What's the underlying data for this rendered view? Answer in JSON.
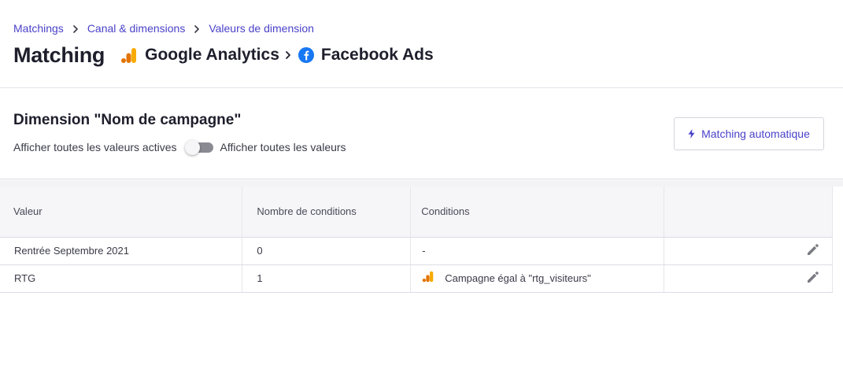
{
  "breadcrumb": {
    "items": [
      "Matchings",
      "Canal & dimensions",
      "Valeurs de dimension"
    ]
  },
  "header": {
    "title": "Matching",
    "source": "Google Analytics",
    "target": "Facebook Ads"
  },
  "dimension": {
    "title": "Dimension \"Nom de campagne\"",
    "toggle_left_label": "Afficher toutes les valeurs actives",
    "toggle_right_label": "Afficher toutes les valeurs",
    "toggle_on": false,
    "auto_button_label": "Matching automatique"
  },
  "table": {
    "columns": [
      "Valeur",
      "Nombre de conditions",
      "Conditions",
      ""
    ],
    "rows": [
      {
        "value": "Rentrée Septembre 2021",
        "count": "0",
        "condition": "-",
        "condition_icon": ""
      },
      {
        "value": "RTG",
        "count": "1",
        "condition": "Campagne égal à \"rtg_visiteurs\"",
        "condition_icon": "google-analytics-icon"
      }
    ]
  },
  "colors": {
    "accent": "#4a42c8",
    "ga_orange": "#f9ab00",
    "ga_dark_orange": "#e37400",
    "facebook_blue": "#1877f2"
  }
}
